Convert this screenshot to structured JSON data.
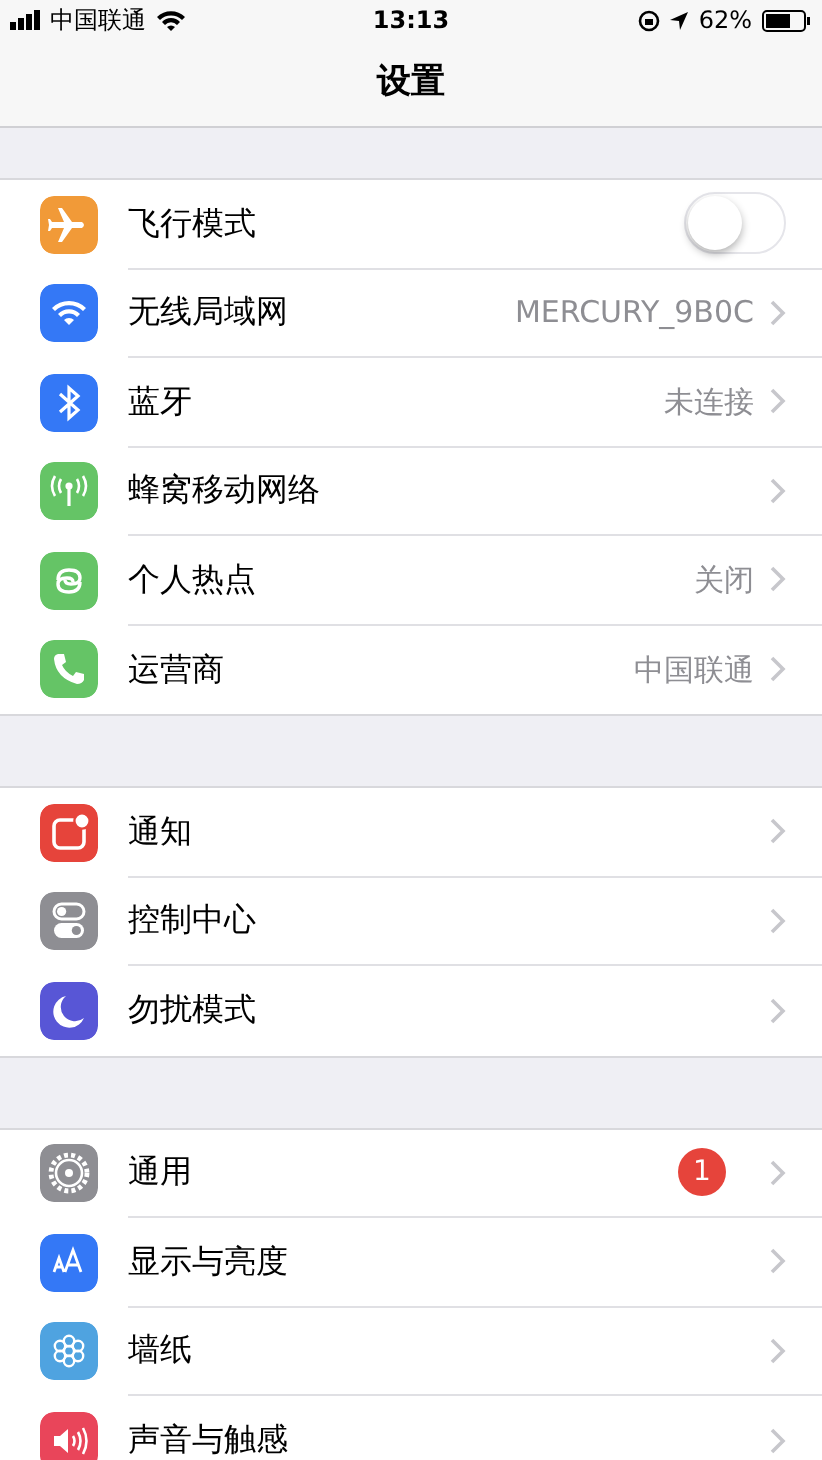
{
  "status_bar": {
    "carrier": "中国联通",
    "time": "13:13",
    "battery": "62%"
  },
  "nav": {
    "title": "设置"
  },
  "groups": [
    {
      "rows": [
        {
          "kind": "toggle",
          "label": "飞行模式",
          "on": false
        },
        {
          "kind": "link",
          "label": "无线局域网",
          "value": "MERCURY_9B0C"
        },
        {
          "kind": "link",
          "label": "蓝牙",
          "value": "未连接"
        },
        {
          "kind": "link",
          "label": "蜂窝移动网络"
        },
        {
          "kind": "link",
          "label": "个人热点",
          "value": "关闭"
        },
        {
          "kind": "link",
          "label": "运营商",
          "value": "中国联通"
        }
      ]
    },
    {
      "rows": [
        {
          "kind": "link",
          "label": "通知"
        },
        {
          "kind": "link",
          "label": "控制中心"
        },
        {
          "kind": "link",
          "label": "勿扰模式"
        }
      ]
    },
    {
      "rows": [
        {
          "kind": "link",
          "label": "通用",
          "badge": "1"
        },
        {
          "kind": "link",
          "label": "显示与亮度"
        },
        {
          "kind": "link",
          "label": "墙纸"
        },
        {
          "kind": "link",
          "label": "声音与触感"
        }
      ]
    }
  ]
}
